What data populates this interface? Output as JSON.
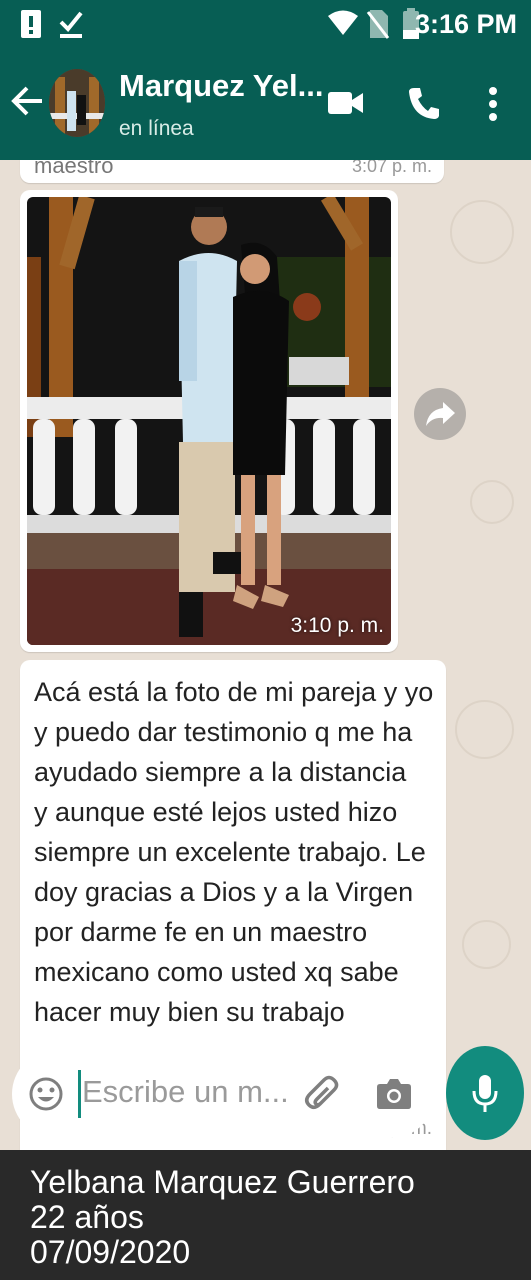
{
  "status_bar": {
    "time": "3:16 PM"
  },
  "header": {
    "contact_name": "Marquez Yel...",
    "status": "en línea"
  },
  "chat": {
    "previous_message": {
      "partial_text": "maestro",
      "time": "3:07 p. m."
    },
    "photo_message": {
      "time": "3:10 p. m."
    },
    "text_message": {
      "text": "Acá está la foto de mi pareja y yo\ny puedo dar testimonio q me ha\nayudado siempre a la distancia\ny aunque esté lejos usted hizo\nsiempre un excelente trabajo. Le\ndoy gracias a Dios y a la Virgen\npor darme fe en un maestro\nmexicano como usted xq sabe\nhacer muy bien su trabajo",
      "time": "3:12 p. m."
    }
  },
  "input": {
    "placeholder": "Escribe un m..."
  },
  "caption": {
    "name": "Yelbana Marquez Guerrero",
    "age": "22 años",
    "date": "07/09/2020"
  },
  "colors": {
    "header": "#075e54",
    "accent": "#128c7e"
  },
  "icons": [
    "alert-icon",
    "check-icon",
    "wifi-icon",
    "no-sim-icon",
    "battery-icon",
    "back-arrow-icon",
    "video-call-icon",
    "phone-icon",
    "more-vert-icon",
    "forward-icon",
    "emoji-icon",
    "attach-icon",
    "camera-icon",
    "mic-icon"
  ]
}
